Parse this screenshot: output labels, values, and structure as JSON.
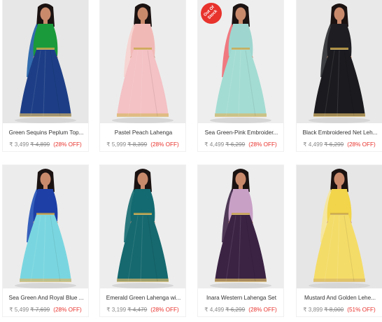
{
  "products": [
    {
      "title": "Green Sequins Peplum Top...",
      "price": "₹ 3,499",
      "mrp": "₹ 4,899",
      "off": "(28% OFF)",
      "bg": "#e7e7e7",
      "top_color": "#1a9a3a",
      "skirt_color": "#1d3e86",
      "dupatta_color": "#1f5fa8",
      "out_of_stock": false
    },
    {
      "title": "Pastel Peach Lahenga",
      "price": "₹ 5,999",
      "mrp": "₹ 8,399",
      "off": "(28% OFF)",
      "bg": "#ececec",
      "top_color": "#f1b9b6",
      "skirt_color": "#f4c1c4",
      "dupatta_color": "#f7d3cf",
      "out_of_stock": false
    },
    {
      "title": "Sea Green-Pink Embroider...",
      "price": "₹ 4,499",
      "mrp": "₹ 6,299",
      "off": "(28% OFF)",
      "bg": "#eeeeee",
      "top_color": "#9ed6cf",
      "skirt_color": "#a3dcd3",
      "dupatta_color": "#f06c73",
      "out_of_stock": true,
      "badge_text": "Out Of Stock"
    },
    {
      "title": "Black Embroidered Net Leh...",
      "price": "₹ 4,499",
      "mrp": "₹ 6,299",
      "off": "(28% OFF)",
      "bg": "#e9e9e9",
      "top_color": "#1e1e22",
      "skirt_color": "#1b1b1f",
      "dupatta_color": "#2b2c30",
      "out_of_stock": false
    },
    {
      "title": "Sea Green And Royal Blue ...",
      "price": "₹ 5,499",
      "mrp": "₹ 7,699",
      "off": "(28% OFF)",
      "bg": "#ececec",
      "top_color": "#1d3fa6",
      "skirt_color": "#79d6e0",
      "dupatta_color": "#2251b7",
      "out_of_stock": false
    },
    {
      "title": "Emerald Green Lahenga wi...",
      "price": "₹ 3,199",
      "mrp": "₹ 4,479",
      "off": "(28% OFF)",
      "bg": "#ededed",
      "top_color": "#136a70",
      "skirt_color": "#15696f",
      "dupatta_color": "#136a70",
      "out_of_stock": false
    },
    {
      "title": "Inara Western Lahenga Set",
      "price": "₹ 4,499",
      "mrp": "₹ 6,299",
      "off": "(28% OFF)",
      "bg": "#ededed",
      "top_color": "#c8a0c6",
      "skirt_color": "#3b2344",
      "dupatta_color": "#3d2546",
      "out_of_stock": false
    },
    {
      "title": "Mustard And Golden Lehe...",
      "price": "₹ 3,899",
      "mrp": "₹ 8,000",
      "off": "(51% OFF)",
      "bg": "#e6e6e6",
      "top_color": "#f2d54a",
      "skirt_color": "#f4dc68",
      "dupatta_color": "#f6e79a",
      "out_of_stock": false
    }
  ]
}
